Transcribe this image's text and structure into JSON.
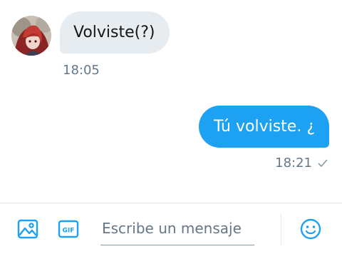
{
  "conversation": {
    "incoming": {
      "text": "Volviste(?)",
      "time": "18:05",
      "avatar": "user-avatar"
    },
    "outgoing": {
      "text": "Tú volviste. ¿",
      "time": "18:21",
      "status_icon": "sent-check-icon"
    }
  },
  "composer": {
    "placeholder": "Escribe un mensaje",
    "value": "",
    "icons": [
      "image-icon",
      "gif-icon",
      "emoji-icon"
    ]
  },
  "colors": {
    "accent": "#1da1f2",
    "incoming_bubble": "#e6ecf0",
    "muted_text": "#657786"
  }
}
